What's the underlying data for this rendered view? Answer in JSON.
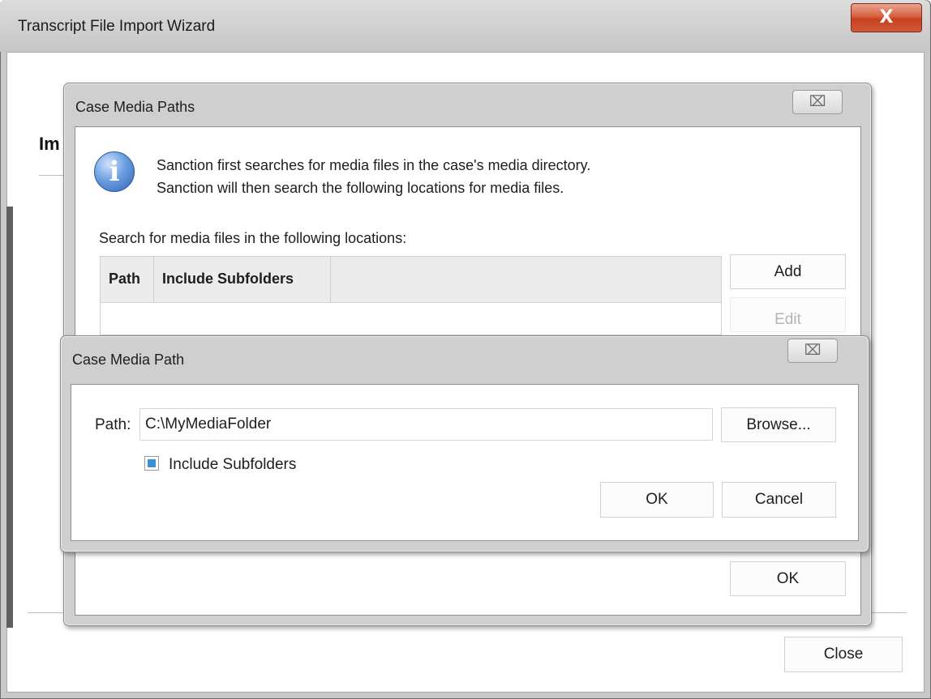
{
  "wizard": {
    "title": "Transcript File Import Wizard",
    "close_glyph": "X",
    "heading_partial": "Im",
    "close_button": "Close"
  },
  "paths_dialog": {
    "title": "Case Media Paths",
    "close_glyph": "⌧",
    "info_icon": "info-icon",
    "info_line1": "Sanction first searches for media files in the case's media directory.",
    "info_line2": "Sanction will then search the following locations for media files.",
    "list_label": "Search for media files in the following locations:",
    "columns": [
      "Path",
      "Include Subfolders"
    ],
    "add_button": "Add",
    "edit_button": "Edit",
    "ok_button": "OK"
  },
  "path_dialog": {
    "title": "Case Media Path",
    "close_glyph": "⌧",
    "path_label": "Path:",
    "path_value": "C:\\MyMediaFolder",
    "browse_button": "Browse...",
    "include_subfolders_label": "Include Subfolders",
    "include_subfolders_checked": true,
    "ok_button": "OK",
    "cancel_button": "Cancel"
  },
  "colors": {
    "close_red": "#c7401f",
    "checkbox_accent": "#3a8fd6",
    "dialog_chrome": "#cfcfcf"
  }
}
